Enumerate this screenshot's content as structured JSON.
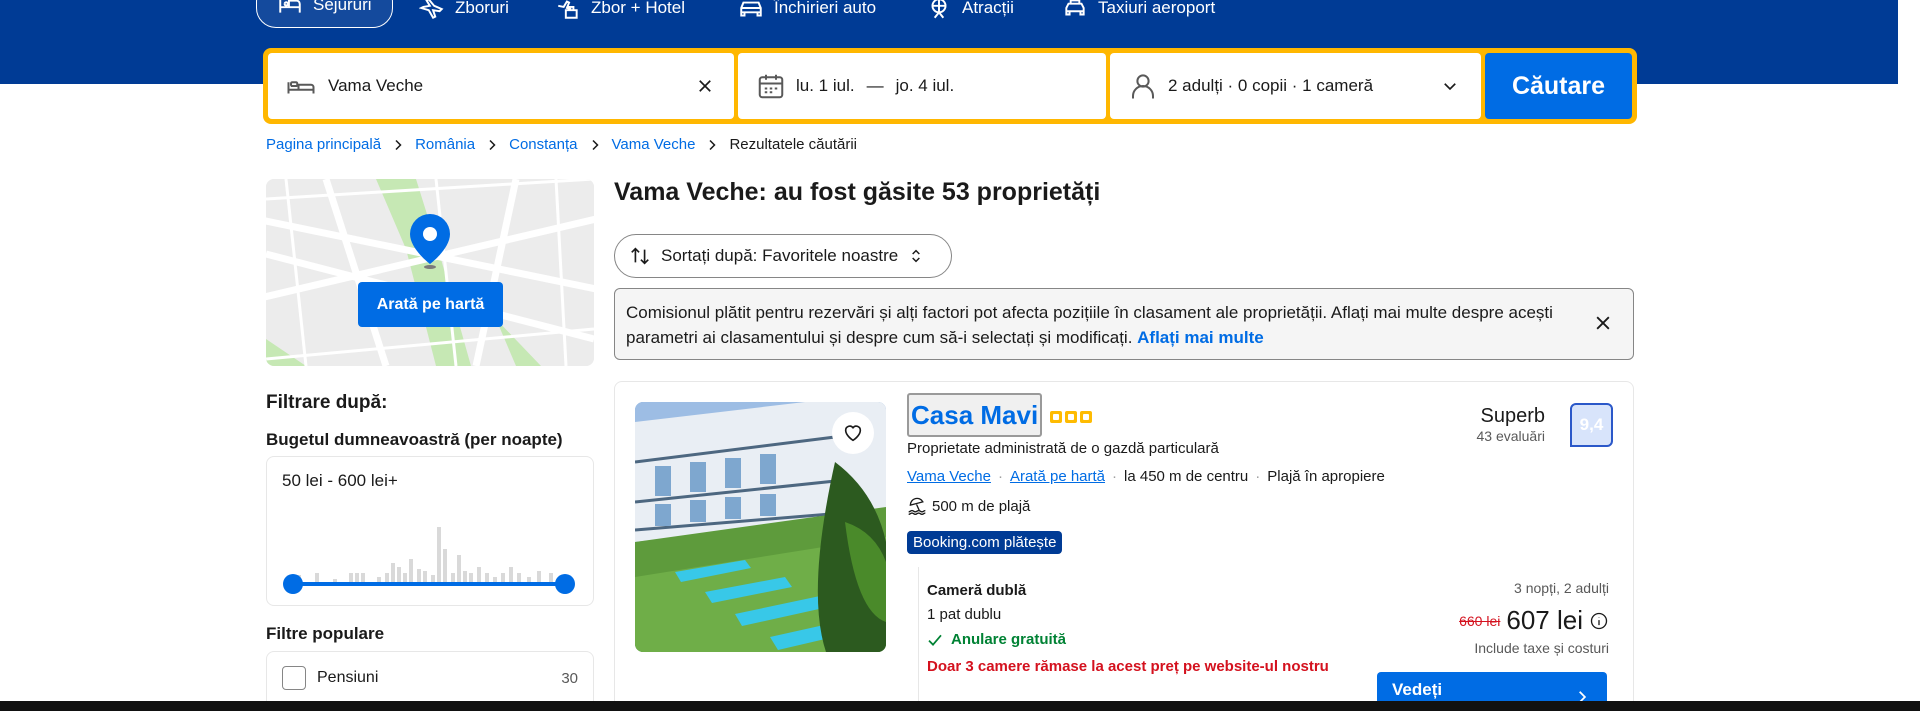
{
  "nav": {
    "items": [
      {
        "label": "Sejururi",
        "icon": "bed-icon",
        "active": true
      },
      {
        "label": "Zboruri",
        "icon": "plane-icon"
      },
      {
        "label": "Zbor + Hotel",
        "icon": "plane-hotel-icon"
      },
      {
        "label": "Închirieri auto",
        "icon": "car-icon"
      },
      {
        "label": "Atracții",
        "icon": "attractions-icon"
      },
      {
        "label": "Taxiuri aeroport",
        "icon": "taxi-icon"
      }
    ]
  },
  "search": {
    "destination": "Vama Veche",
    "date_from": "lu. 1 iul.",
    "date_separator": "—",
    "date_to": "jo. 4 iul.",
    "occupancy": "2 adulți · 0 copii · 1 cameră",
    "submit_label": "Căutare"
  },
  "breadcrumb": [
    "Pagina principală",
    "România",
    "Constanța",
    "Vama Veche",
    "Rezultatele căutării"
  ],
  "map": {
    "button_label": "Arată pe hartă"
  },
  "filters": {
    "heading": "Filtrare după:",
    "budget_heading": "Bugetul dumneavoastră (per noapte)",
    "budget_range": "50 lei - 600 lei+",
    "popular_heading": "Filtre populare",
    "popular_items": [
      {
        "label": "Pensiuni",
        "count": "30"
      }
    ]
  },
  "results": {
    "title": "Vama Veche: au fost găsite 53 proprietăți",
    "sort_label": "Sortați după: Favoritele noastre",
    "notice_text": "Comisionul plătit pentru rezervări și alți factori pot afecta pozițiile în clasament ale proprietății. Aflați mai multe despre acești parametri ai clasamentului și despre cum să-i selectați și modificați. ",
    "notice_link": "Aflați mai multe"
  },
  "property": {
    "name": "Casa Mavi",
    "stars": 3,
    "host": "Proprietate administrată de o gazdă particulară",
    "location": "Vama Veche",
    "map_link": "Arată pe hartă",
    "distance": "la 450 m de centru",
    "beach_note": "Plajă în apropiere",
    "beach_distance": "500 m de plajă",
    "pays_badge": "Booking.com plătește",
    "score_word": "Superb",
    "reviews": "43 evaluări",
    "score": "9,4",
    "room_type": "Cameră dublă",
    "bed": "1 pat dublu",
    "cancellation": "Anulare gratuită",
    "scarcity": "Doar 3 camere rămase la acest preț pe website-ul nostru",
    "stay_info": "3 nopți, 2 adulți",
    "old_price": "660 lei",
    "price": "607 lei",
    "taxes": "Include taxe și costuri",
    "cta": "Vedeți"
  },
  "colors": {
    "brand_blue": "#003b95",
    "search_border": "#ffb700",
    "action_blue": "#006ce4",
    "success_green": "#008234",
    "alert_red": "#d4111e"
  }
}
